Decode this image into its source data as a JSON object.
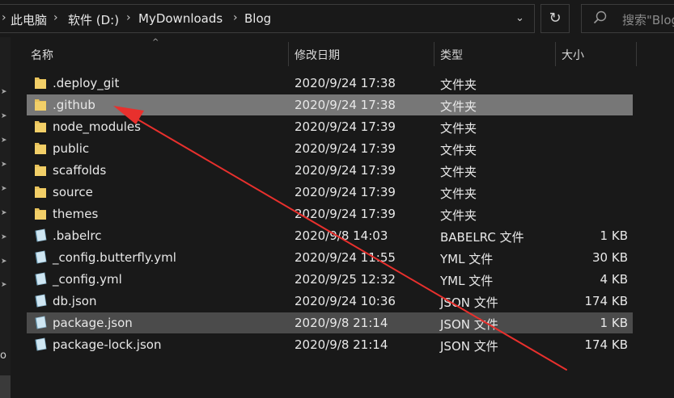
{
  "breadcrumb": {
    "items": [
      "此电脑",
      "软件 (D:)",
      "MyDownloads",
      "Blog"
    ]
  },
  "search": {
    "placeholder": "搜索\"Blog\""
  },
  "columns": {
    "name": "名称",
    "date": "修改日期",
    "type": "类型",
    "size": "大小"
  },
  "files": [
    {
      "name": ".deploy_git",
      "date": "2020/9/24 17:38",
      "type": "文件夹",
      "size": "",
      "icon": "folder-icon",
      "state": ""
    },
    {
      "name": ".github",
      "date": "2020/9/24 17:38",
      "type": "文件夹",
      "size": "",
      "icon": "folder-icon",
      "state": "selected"
    },
    {
      "name": "node_modules",
      "date": "2020/9/24 17:39",
      "type": "文件夹",
      "size": "",
      "icon": "folder-icon",
      "state": ""
    },
    {
      "name": "public",
      "date": "2020/9/24 17:39",
      "type": "文件夹",
      "size": "",
      "icon": "folder-icon",
      "state": ""
    },
    {
      "name": "scaffolds",
      "date": "2020/9/24 17:39",
      "type": "文件夹",
      "size": "",
      "icon": "folder-icon",
      "state": ""
    },
    {
      "name": "source",
      "date": "2020/9/24 17:39",
      "type": "文件夹",
      "size": "",
      "icon": "folder-icon",
      "state": ""
    },
    {
      "name": "themes",
      "date": "2020/9/24 17:39",
      "type": "文件夹",
      "size": "",
      "icon": "folder-icon",
      "state": ""
    },
    {
      "name": ".babelrc",
      "date": "2020/9/8 14:03",
      "type": "BABELRC 文件",
      "size": "1 KB",
      "icon": "file-icon",
      "state": ""
    },
    {
      "name": "_config.butterfly.yml",
      "date": "2020/9/24 11:55",
      "type": "YML 文件",
      "size": "30 KB",
      "icon": "file-icon",
      "state": ""
    },
    {
      "name": "_config.yml",
      "date": "2020/9/25 12:32",
      "type": "YML 文件",
      "size": "4 KB",
      "icon": "file-icon",
      "state": ""
    },
    {
      "name": "db.json",
      "date": "2020/9/24 10:36",
      "type": "JSON 文件",
      "size": "174 KB",
      "icon": "file-icon",
      "state": ""
    },
    {
      "name": "package.json",
      "date": "2020/9/8 21:14",
      "type": "JSON 文件",
      "size": "1 KB",
      "icon": "file-icon",
      "state": "hover"
    },
    {
      "name": "package-lock.json",
      "date": "2020/9/8 21:14",
      "type": "JSON 文件",
      "size": "174 KB",
      "icon": "file-icon",
      "state": ""
    }
  ],
  "leftpane": {
    "partial_label": "o"
  },
  "colors": {
    "background": "#191919",
    "selected_row": "#777777",
    "hover_row": "#4b4b4b",
    "folder": "#e8c25a",
    "arrow": "#e8302d"
  },
  "icons": {
    "refresh": "refresh-icon",
    "search": "search-icon",
    "pin": "pin-icon",
    "sort": "sort-ascending-icon",
    "dropdown": "chevron-down-icon"
  }
}
